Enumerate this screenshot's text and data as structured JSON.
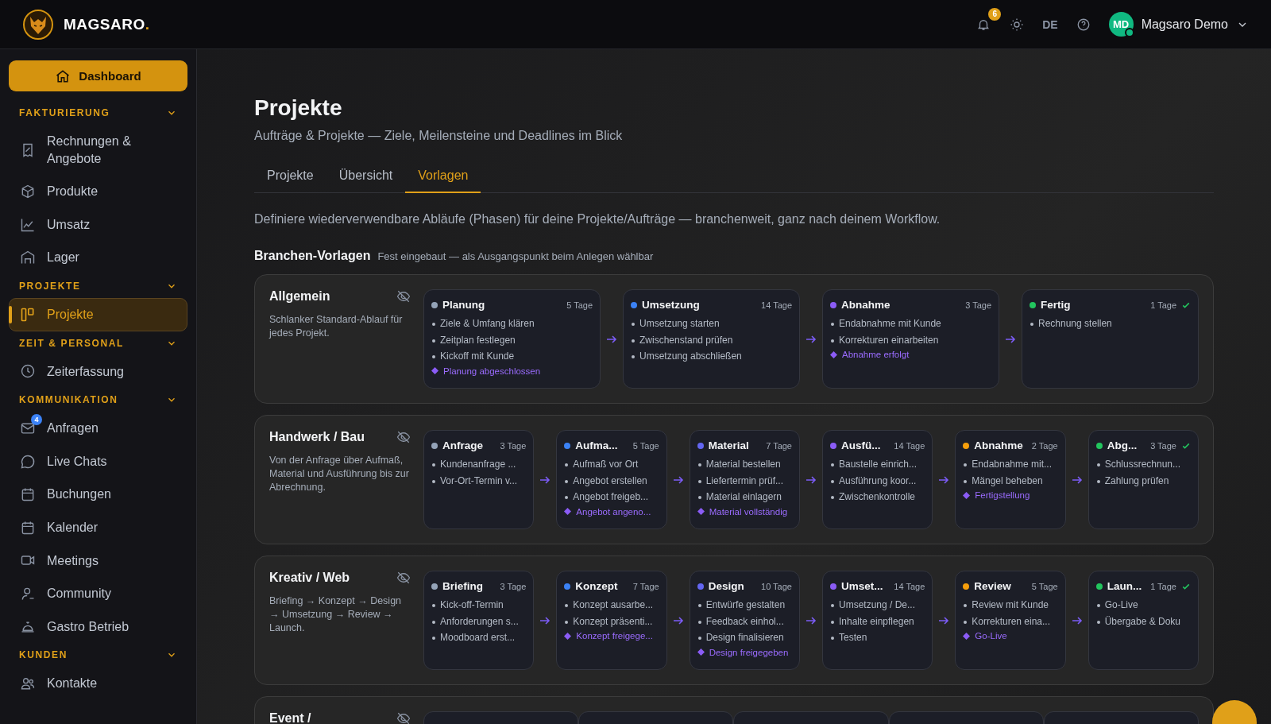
{
  "header": {
    "brand": "MAGSARO.",
    "notifications": "6",
    "language": "DE",
    "user": {
      "initials": "MD",
      "name": "Magsaro Demo",
      "online": true
    }
  },
  "sidebar": {
    "dashboard": "Dashboard",
    "sections": [
      {
        "title": "FAKTURIERUNG",
        "expanded": true,
        "items": [
          {
            "label": "Rechnungen & Angebote",
            "selected": false
          },
          {
            "label": "Produkte",
            "selected": false
          },
          {
            "label": "Umsatz",
            "selected": false
          },
          {
            "label": "Lager",
            "selected": false
          }
        ]
      },
      {
        "title": "PROJEKTE",
        "expanded": true,
        "items": [
          {
            "label": "Projekte",
            "selected": true
          }
        ]
      },
      {
        "title": "ZEIT & PERSONAL",
        "expanded": true,
        "items": [
          {
            "label": "Zeiterfassung",
            "selected": false
          }
        ]
      },
      {
        "title": "KOMMUNIKATION",
        "expanded": true,
        "items": [
          {
            "label": "Anfragen",
            "selected": false,
            "badge": "4"
          },
          {
            "label": "Live Chats",
            "selected": false
          },
          {
            "label": "Buchungen",
            "selected": false
          },
          {
            "label": "Kalender",
            "selected": false
          },
          {
            "label": "Meetings",
            "selected": false
          },
          {
            "label": "Community",
            "selected": false
          },
          {
            "label": "Gastro Betrieb",
            "selected": false
          }
        ]
      },
      {
        "title": "KUNDEN",
        "expanded": true,
        "items": [
          {
            "label": "Kontakte",
            "selected": false
          }
        ]
      }
    ]
  },
  "page": {
    "title": "Projekte",
    "subtitle": "Aufträge & Projekte — Ziele, Meilensteine und Deadlines im Blick",
    "tabs": [
      {
        "label": "Projekte",
        "selected": false
      },
      {
        "label": "Übersicht",
        "selected": false
      },
      {
        "label": "Vorlagen",
        "selected": true
      }
    ],
    "intro": "Definiere wiederverwendbare Abläufe (Phasen) für deine Projekte/Aufträge — branchenweit, ganz nach deinem Workflow.",
    "section": {
      "title": "Branchen-Vorlagen",
      "note": "Fest eingebaut — als Ausgangspunkt beim Anlegen wählbar"
    },
    "templates": [
      {
        "name": "Allgemein",
        "description": "Schlanker Standard-Ablauf für jedes Projekt.",
        "phases": [
          {
            "name": "Planung",
            "days": "5 Tage",
            "color": "#94a3b8",
            "final": false,
            "tasks": [
              "Ziele & Umfang klären",
              "Zeitplan festlegen",
              "Kickoff mit Kunde"
            ],
            "milestone": "Planung abgeschlossen"
          },
          {
            "name": "Umsetzung",
            "days": "14 Tage",
            "color": "#3b82f6",
            "final": false,
            "tasks": [
              "Umsetzung starten",
              "Zwischenstand prüfen",
              "Umsetzung abschließen"
            ]
          },
          {
            "name": "Abnahme",
            "days": "3 Tage",
            "color": "#8b5cf6",
            "final": false,
            "tasks": [
              "Endabnahme mit Kunde",
              "Korrekturen einarbeiten"
            ],
            "milestone": "Abnahme erfolgt"
          },
          {
            "name": "Fertig",
            "days": "1 Tage",
            "color": "#22c55e",
            "final": true,
            "tasks": [
              "Rechnung stellen"
            ]
          }
        ]
      },
      {
        "name": "Handwerk / Bau",
        "description": "Von der Anfrage über Aufmaß, Material und Ausführung bis zur Abrechnung.",
        "phases": [
          {
            "name": "Anfrage",
            "days": "3 Tage",
            "color": "#94a3b8",
            "final": false,
            "tasks": [
              "Kundenanfrage ...",
              "Vor-Ort-Termin v..."
            ]
          },
          {
            "name": "Aufma...",
            "days": "5 Tage",
            "color": "#3b82f6",
            "final": false,
            "tasks": [
              "Aufmaß vor Ort",
              "Angebot erstellen",
              "Angebot freigeb..."
            ],
            "milestone": "Angebot angeno..."
          },
          {
            "name": "Material",
            "days": "7 Tage",
            "color": "#6366f1",
            "final": false,
            "tasks": [
              "Material bestellen",
              "Liefertermin prüf...",
              "Material einlagern"
            ],
            "milestone": "Material vollständig"
          },
          {
            "name": "Ausfü...",
            "days": "14 Tage",
            "color": "#8b5cf6",
            "final": false,
            "tasks": [
              "Baustelle einrich...",
              "Ausführung koor...",
              "Zwischenkontrolle"
            ]
          },
          {
            "name": "Abnahme",
            "days": "2 Tage",
            "color": "#f59e0b",
            "final": false,
            "tasks": [
              "Endabnahme mit...",
              "Mängel beheben"
            ],
            "milestone": "Fertigstellung"
          },
          {
            "name": "Abg...",
            "days": "3 Tage",
            "color": "#22c55e",
            "final": true,
            "tasks": [
              "Schlussrechnun...",
              "Zahlung prüfen"
            ]
          }
        ]
      },
      {
        "name": "Kreativ / Web",
        "description": "Briefing → Konzept → Design → Umsetzung → Review → Launch.",
        "phases": [
          {
            "name": "Briefing",
            "days": "3 Tage",
            "color": "#94a3b8",
            "final": false,
            "tasks": [
              "Kick-off-Termin",
              "Anforderungen s...",
              "Moodboard erst..."
            ]
          },
          {
            "name": "Konzept",
            "days": "7 Tage",
            "color": "#3b82f6",
            "final": false,
            "tasks": [
              "Konzept ausarbe...",
              "Konzept präsenti..."
            ],
            "milestone": "Konzept freigege..."
          },
          {
            "name": "Design",
            "days": "10 Tage",
            "color": "#6366f1",
            "final": false,
            "tasks": [
              "Entwürfe gestalten",
              "Feedback einhol...",
              "Design finalisieren"
            ],
            "milestone": "Design freigegeben"
          },
          {
            "name": "Umset...",
            "days": "14 Tage",
            "color": "#8b5cf6",
            "final": false,
            "tasks": [
              "Umsetzung / De...",
              "Inhalte einpflegen",
              "Testen"
            ]
          },
          {
            "name": "Review",
            "days": "5 Tage",
            "color": "#f59e0b",
            "final": false,
            "tasks": [
              "Review mit Kunde",
              "Korrekturen eina..."
            ],
            "milestone": "Go-Live"
          },
          {
            "name": "Laun...",
            "days": "1 Tage",
            "color": "#22c55e",
            "final": true,
            "tasks": [
              "Go-Live",
              "Übergabe & Doku"
            ]
          }
        ]
      },
      {
        "name": "Event /",
        "phases": [
          {
            "kind": "hidden"
          },
          {
            "kind": "hidden"
          },
          {
            "kind": "hidden"
          },
          {
            "kind": "hidden"
          },
          {
            "kind": "hidden"
          }
        ]
      }
    ]
  }
}
